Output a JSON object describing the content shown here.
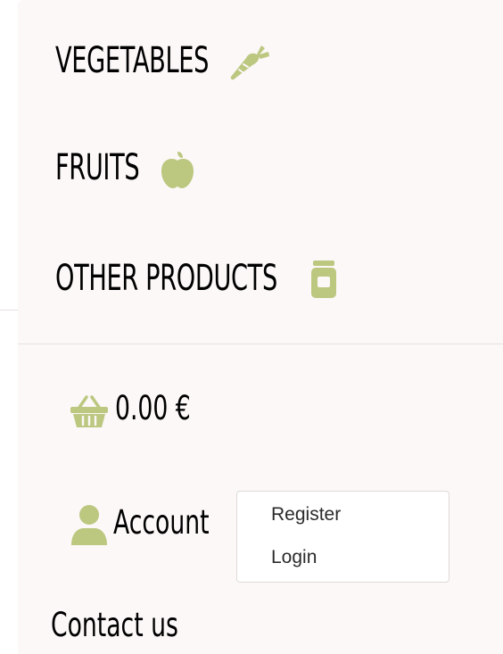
{
  "colors": {
    "panel_background": "#fcf8f7",
    "icon_green": "#bcc780",
    "text": "#000000"
  },
  "nav": {
    "items": [
      {
        "label": "VEGETABLES",
        "icon": "carrot-icon"
      },
      {
        "label": "FRUITS",
        "icon": "apple-icon"
      },
      {
        "label": "OTHER PRODUCTS",
        "icon": "jar-icon"
      }
    ]
  },
  "cart": {
    "icon": "basket-icon",
    "total": "0.00 €"
  },
  "account": {
    "icon": "user-icon",
    "label": "Account",
    "menu": [
      "Register",
      "Login"
    ]
  },
  "contact": {
    "label": "Contact us"
  }
}
